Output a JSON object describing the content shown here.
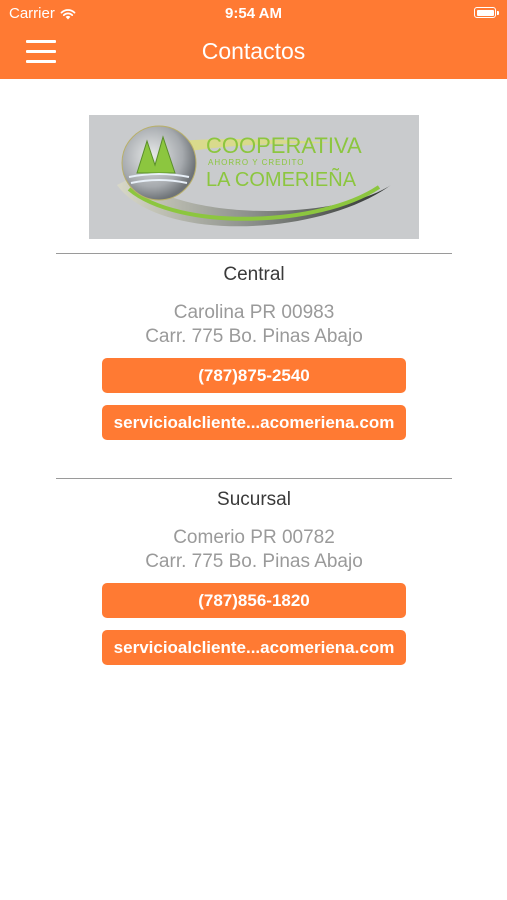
{
  "status_bar": {
    "carrier": "Carrier",
    "time": "9:54 AM"
  },
  "header": {
    "title": "Contactos",
    "menu_icon": "hamburger-menu-icon",
    "color": "#ff7a33"
  },
  "logo": {
    "line1": "COOPERATIVA",
    "line2": "AHORRO Y CREDITO",
    "line3": "LA COMERIEÑA"
  },
  "contacts": [
    {
      "name": "Central",
      "city": "Carolina PR 00983",
      "street": "Carr. 775 Bo. Pinas Abajo",
      "phone": "(787)875-2540",
      "email": "servicioalcliente...acomeriena.com"
    },
    {
      "name": "Sucursal",
      "city": "Comerio PR 00782",
      "street": "Carr. 775 Bo. Pinas Abajo",
      "phone": "(787)856-1820",
      "email": "servicioalcliente...acomeriena.com"
    }
  ]
}
